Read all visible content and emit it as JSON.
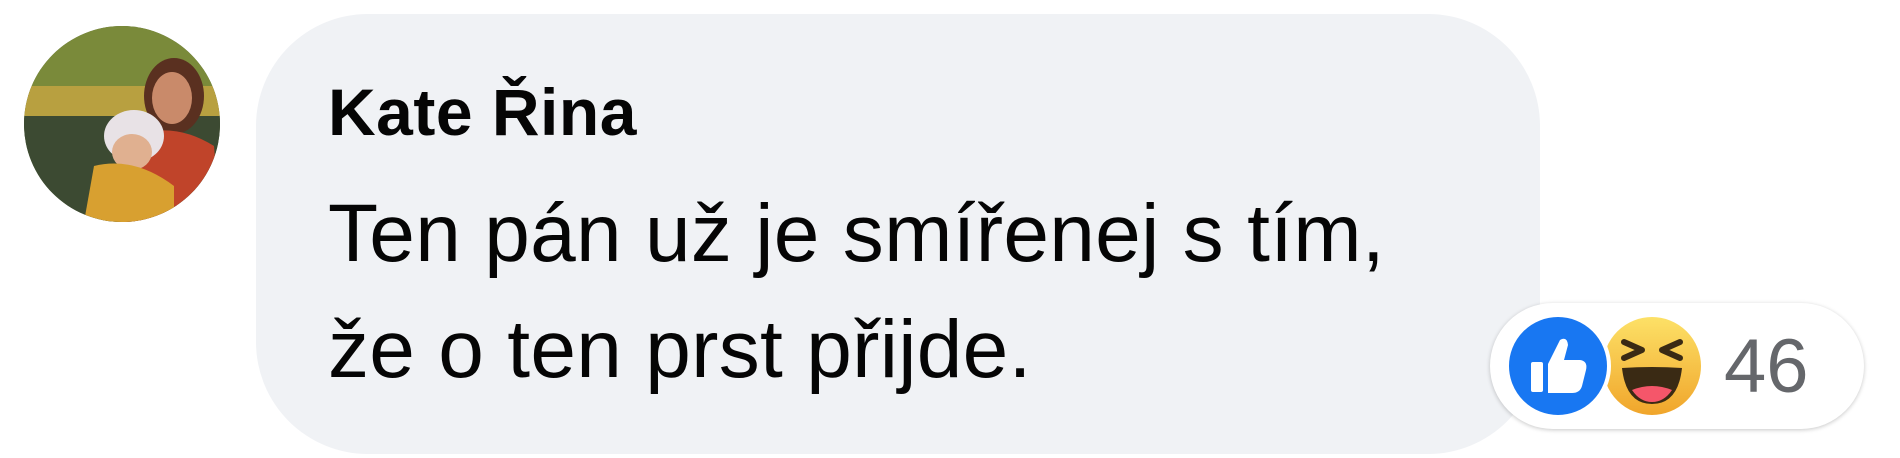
{
  "comment": {
    "author": "Kate Řina",
    "text": "Ten pán už je smířenej s tím, že o ten prst přijde.",
    "avatar": "profile-photo",
    "reactions": {
      "icons": [
        "like-icon",
        "haha-icon"
      ],
      "count": "46",
      "colors": {
        "like": "#1877f2",
        "haha": "#f7c33a",
        "count_text": "#65676b"
      }
    },
    "colors": {
      "bubble": "#f0f2f5",
      "text": "#050505"
    }
  }
}
